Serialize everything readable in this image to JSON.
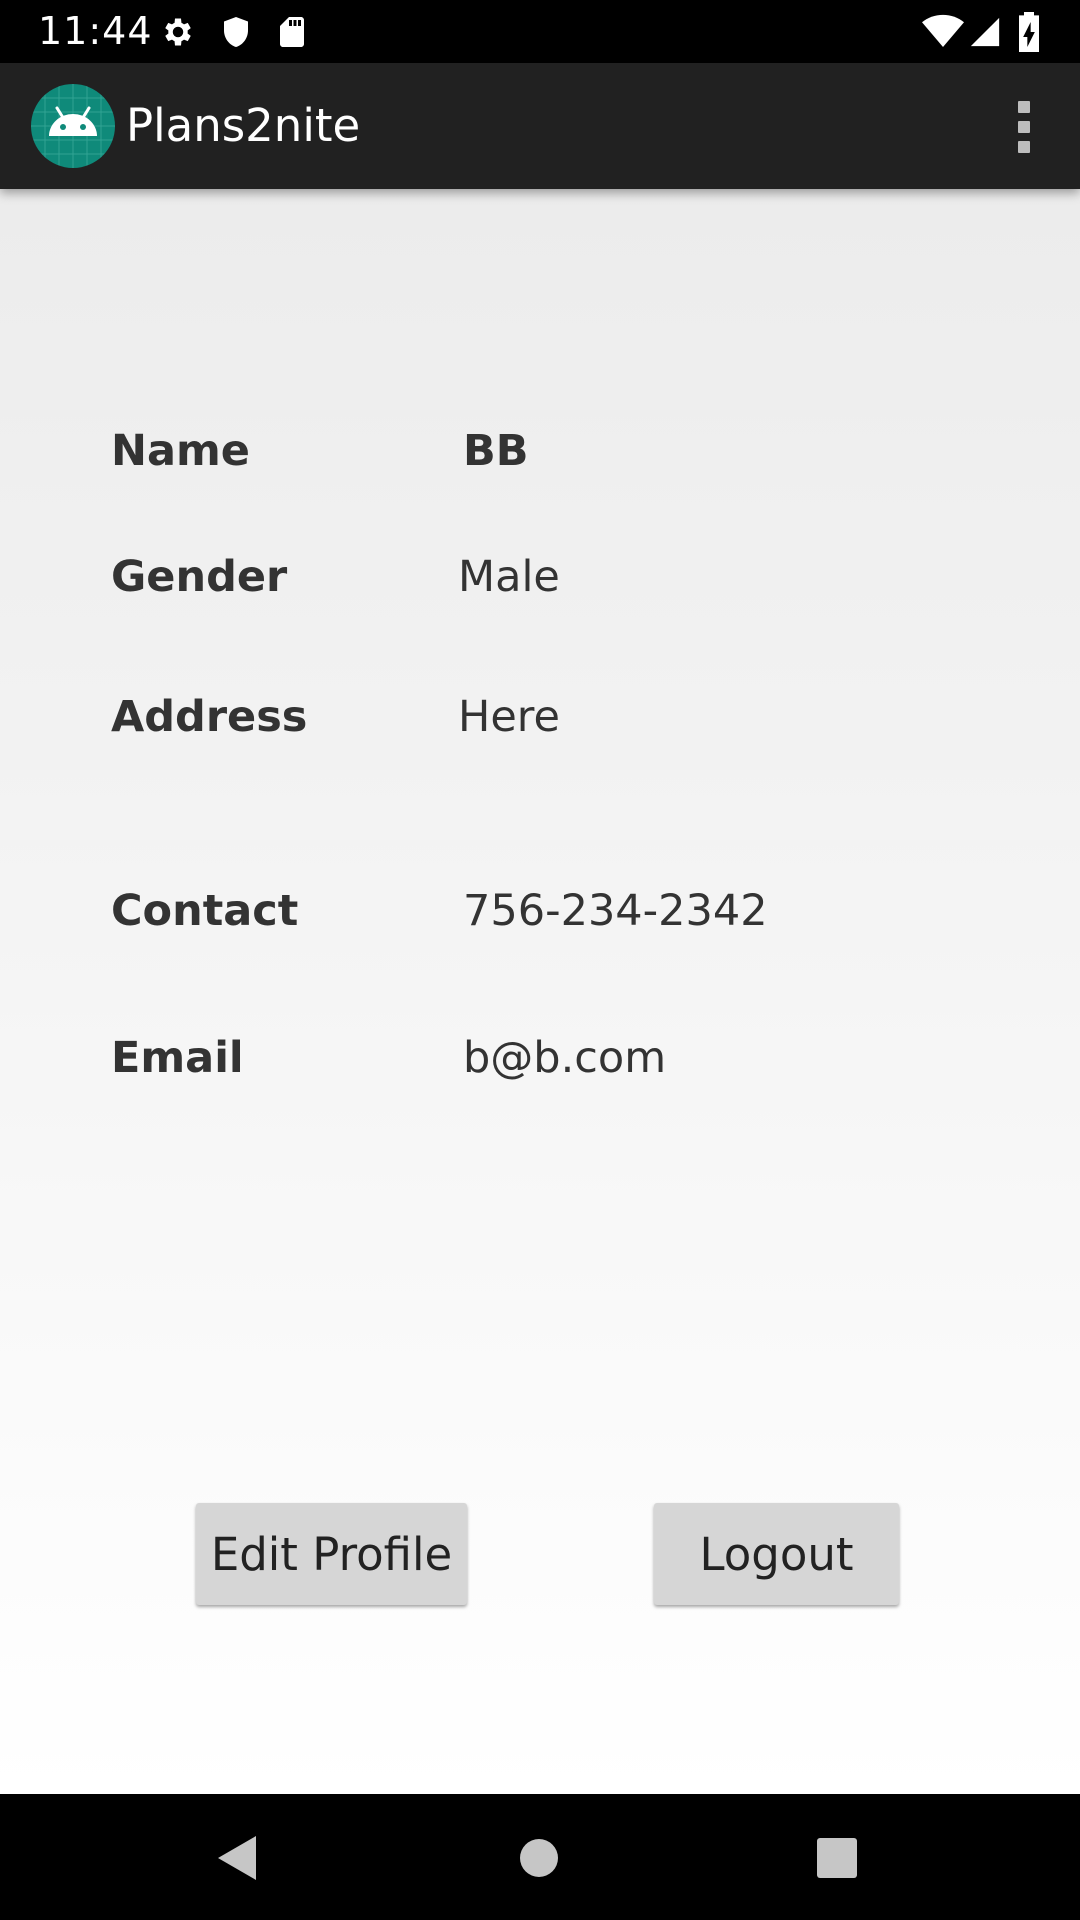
{
  "status_bar": {
    "time": "11:44",
    "left_icons": [
      "settings-gear-icon",
      "shield-icon",
      "sd-card-icon"
    ],
    "right_icons": [
      "wifi-icon",
      "cell-signal-icon",
      "battery-charging-icon"
    ]
  },
  "app_bar": {
    "title": "Plans2nite",
    "logo_icon": "android-robot-icon",
    "menu_icon": "overflow-menu-icon",
    "background": "#212121"
  },
  "profile": {
    "name_label": "Name",
    "name_value": "BB",
    "gender_label": "Gender",
    "gender_value": "Male",
    "address_label": "Address",
    "address_value": "Here",
    "contact_label": "Contact",
    "contact_value": "756-234-2342",
    "email_label": "Email",
    "email_value": "b@b.com"
  },
  "actions": {
    "edit_label": "Edit Profile",
    "logout_label": "Logout"
  },
  "nav_bar": {
    "back_icon": "back-triangle-icon",
    "home_icon": "home-circle-icon",
    "recents_icon": "recents-square-icon"
  }
}
